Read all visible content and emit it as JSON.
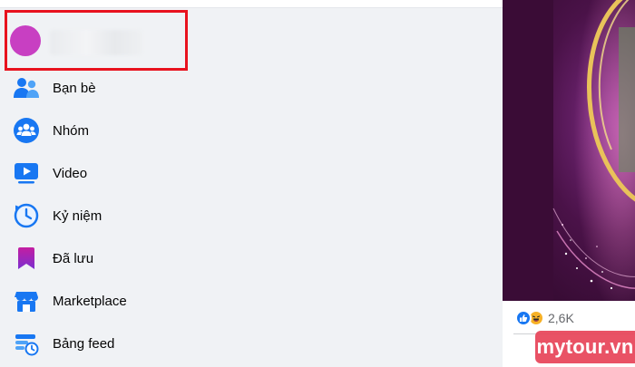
{
  "profile": {
    "name": ""
  },
  "menu": {
    "items": [
      {
        "label": "Bạn bè"
      },
      {
        "label": "Nhóm"
      },
      {
        "label": "Video"
      },
      {
        "label": "Kỷ niệm"
      },
      {
        "label": "Đã lưu"
      },
      {
        "label": "Marketplace"
      },
      {
        "label": "Bảng feed"
      }
    ]
  },
  "post": {
    "reaction_count": "2,6K"
  },
  "watermark": {
    "text": "mytour.vn"
  },
  "colors": {
    "highlight": "#e8121e",
    "avatar": "#c83fc2",
    "facebook_blue": "#1877f2",
    "sidebar_bg": "#f0f2f5",
    "watermark_bg": "#e74358"
  },
  "icons": [
    "friends-icon",
    "groups-icon",
    "video-icon",
    "memories-icon",
    "saved-icon",
    "marketplace-icon",
    "feeds-icon",
    "like-reaction-icon",
    "haha-reaction-icon"
  ]
}
